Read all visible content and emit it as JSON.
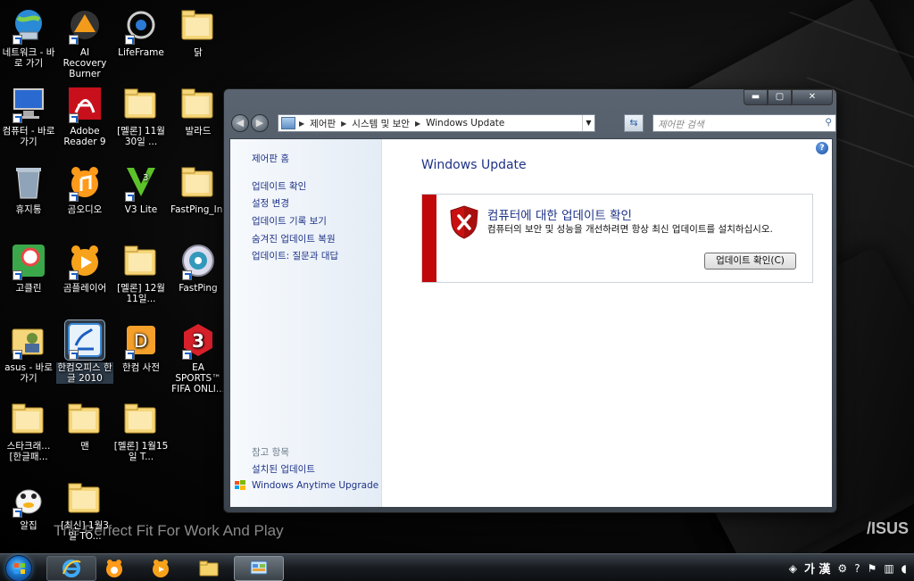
{
  "desktop": {
    "tagline": "The Perfect Fit For Work And Play",
    "brand_logo": "/ISUS",
    "icons": [
      {
        "label": "네트워크 - 바로 가기",
        "icon": "network-icon",
        "shortcut": true
      },
      {
        "label": "AI Recovery Burner",
        "icon": "ai-recovery-icon",
        "shortcut": true
      },
      {
        "label": "LifeFrame",
        "icon": "lifeframe-icon",
        "shortcut": true
      },
      {
        "label": "닭",
        "icon": "folder-icon",
        "shortcut": false
      },
      {
        "label": "컴퓨터 - 바로 가기",
        "icon": "computer-icon",
        "shortcut": true
      },
      {
        "label": "Adobe Reader 9",
        "icon": "adobe-reader-icon",
        "shortcut": true
      },
      {
        "label": "[멜론] 11월30일 ...",
        "icon": "folder-icon",
        "shortcut": false
      },
      {
        "label": "발라드",
        "icon": "folder-icon",
        "shortcut": false
      },
      {
        "label": "휴지통",
        "icon": "recycle-bin-icon",
        "shortcut": false
      },
      {
        "label": "곰오디오",
        "icon": "gom-audio-icon",
        "shortcut": true
      },
      {
        "label": "V3 Lite",
        "icon": "v3-lite-icon",
        "shortcut": true
      },
      {
        "label": "FastPing_In...",
        "icon": "folder-icon",
        "shortcut": false
      },
      {
        "label": "고클린",
        "icon": "goclean-icon",
        "shortcut": true
      },
      {
        "label": "곰플레이어",
        "icon": "gom-player-icon",
        "shortcut": true
      },
      {
        "label": "[멜론] 12월11일...",
        "icon": "folder-icon",
        "shortcut": false
      },
      {
        "label": "FastPing",
        "icon": "fastping-icon",
        "shortcut": true
      },
      {
        "label": "asus - 바로 가기",
        "icon": "user-folder-icon",
        "shortcut": true
      },
      {
        "label": "한컴오피스 한글 2010",
        "icon": "hangul-icon",
        "shortcut": true
      },
      {
        "label": "한컴 사전",
        "icon": "hancom-dictionary-icon",
        "shortcut": true
      },
      {
        "label": "EA SPORTS™ FIFA ONLI...",
        "icon": "fifa-online-icon",
        "shortcut": true
      },
      {
        "label": "스타크래... [한글패...",
        "icon": "folder-icon",
        "shortcut": false
      },
      {
        "label": "맨",
        "icon": "folder-icon",
        "shortcut": false
      },
      {
        "label": "[멜론] 1월15일 T...",
        "icon": "folder-icon",
        "shortcut": false
      },
      {
        "label": "알집",
        "icon": "alzip-icon",
        "shortcut": true
      },
      {
        "label": "[최신] 1월3일 TO...",
        "icon": "folder-icon",
        "shortcut": false
      }
    ]
  },
  "window": {
    "caption_buttons": {
      "minimize": "▬",
      "maximize": "▢",
      "close": "✕"
    },
    "address": {
      "segments": [
        "제어판",
        "시스템 및 보안",
        "Windows Update"
      ],
      "separator": "▶"
    },
    "search": {
      "placeholder": "제어판 검색"
    },
    "sidebar": {
      "home": "제어판 홈",
      "links": [
        "업데이트 확인",
        "설정 변경",
        "업데이트 기록 보기",
        "숨겨진 업데이트 복원",
        "업데이트: 질문과 대답"
      ],
      "see_also_heading": "참고 항목",
      "see_also_links": [
        "설치된 업데이트",
        "Windows Anytime Upgrade"
      ]
    },
    "main": {
      "title": "Windows Update",
      "status": {
        "heading": "컴퓨터에 대한 업데이트 확인",
        "description": "컴퓨터의 보안 및 성능을 개선하려면 항상 최신 업데이트를 설치하십시오.",
        "button": "업데이트 확인(C)"
      }
    }
  },
  "taskbar": {
    "tray": {
      "ime_label": "가 漢",
      "icons": [
        "language-bar-icon",
        "ime-settings-icon",
        "help-icon",
        "action-center-icon",
        "network-tray-icon",
        "volume-icon"
      ]
    }
  }
}
